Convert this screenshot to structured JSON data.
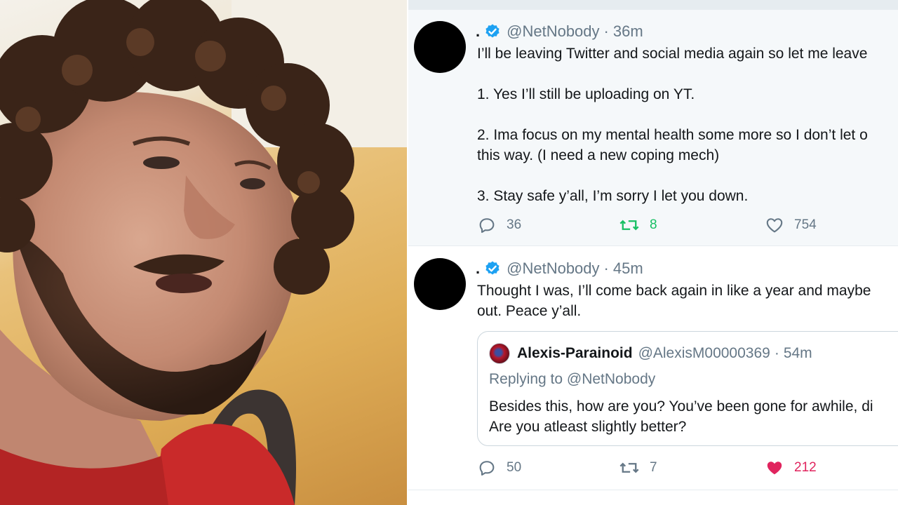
{
  "tweets": [
    {
      "display_name": ".",
      "handle": "@NetNobody",
      "separator": "·",
      "time": "36m",
      "text_lines": [
        "I’ll be leaving Twitter and social media again so let me leave",
        "",
        "1. Yes I’ll still be uploading on YT.",
        "",
        "2. Ima focus on my mental health some more so I don’t let o",
        "this way. (I need a new coping mech)",
        "",
        "3. Stay safe y’all, I’m sorry I let you down."
      ],
      "replies": "36",
      "retweets": "8",
      "likes": "754",
      "retweeted": true,
      "liked": false
    },
    {
      "display_name": ".",
      "handle": "@NetNobody",
      "separator": "·",
      "time": "45m",
      "text_lines": [
        "Thought I was, I’ll come back again in like a year and maybe",
        "out. Peace y’all."
      ],
      "quote": {
        "display_name": "Alexis-Parainoid",
        "handle": "@AlexisM00000369",
        "separator": "·",
        "time": "54m",
        "replying_to": "Replying to @NetNobody",
        "text_lines": [
          "Besides this, how are you? You’ve been gone for awhile, di",
          "Are you atleast slightly better?"
        ]
      },
      "replies": "50",
      "retweets": "7",
      "likes": "212",
      "retweeted": false,
      "liked": true
    }
  ],
  "colors": {
    "verified": "#1da1f2",
    "retweet_active": "#17bf63",
    "like_active": "#e0245e",
    "muted": "#657786",
    "text": "#14171a"
  }
}
